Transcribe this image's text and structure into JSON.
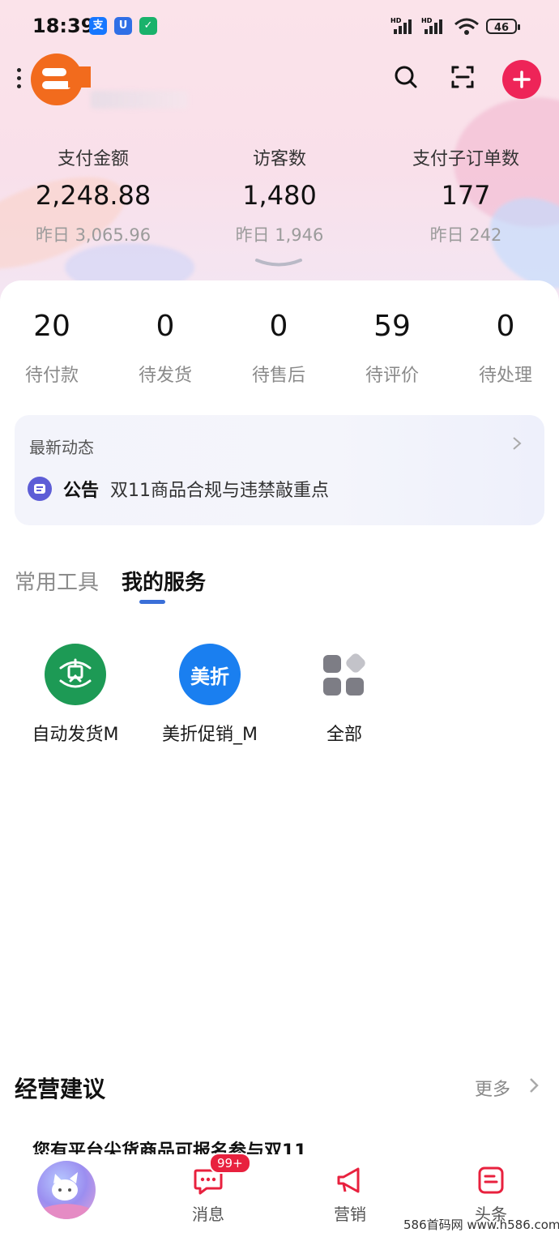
{
  "status_bar": {
    "time": "18:39",
    "battery": "46"
  },
  "stats": [
    {
      "label": "支付金额",
      "value": "2,248.88",
      "yesterday": "昨日 3,065.96"
    },
    {
      "label": "访客数",
      "value": "1,480",
      "yesterday": "昨日 1,946"
    },
    {
      "label": "支付子订单数",
      "value": "177",
      "yesterday": "昨日 242"
    }
  ],
  "orders": [
    {
      "count": "20",
      "label": "待付款"
    },
    {
      "count": "0",
      "label": "待发货"
    },
    {
      "count": "0",
      "label": "待售后"
    },
    {
      "count": "59",
      "label": "待评价"
    },
    {
      "count": "0",
      "label": "待处理"
    }
  ],
  "news": {
    "title": "最新动态",
    "tag": "公告",
    "text": "双11商品合规与违禁敲重点"
  },
  "tabs": {
    "tools": "常用工具",
    "services": "我的服务"
  },
  "services": [
    {
      "name": "自动发货M",
      "icon": "auto-ship-icon",
      "color": "#1d9a55"
    },
    {
      "name": "美折促销_M",
      "icon": "meizhe-icon",
      "icon_text": "美折",
      "color": "#1a7ff0"
    },
    {
      "name": "全部",
      "icon": "all-apps-icon",
      "color": "#7d7d85"
    }
  ],
  "advice": {
    "title": "经营建议",
    "more": "更多",
    "item": "您有平台尖货商品可报名参与双11"
  },
  "tabbar": {
    "messages": "消息",
    "messages_badge": "99+",
    "marketing": "营销",
    "headlines": "头条"
  },
  "colors": {
    "accent": "#ee2458",
    "tab_active": "#3a6fd8",
    "news_badge": "#5d5dd6"
  },
  "watermark": "586首码网 www.h586.com"
}
